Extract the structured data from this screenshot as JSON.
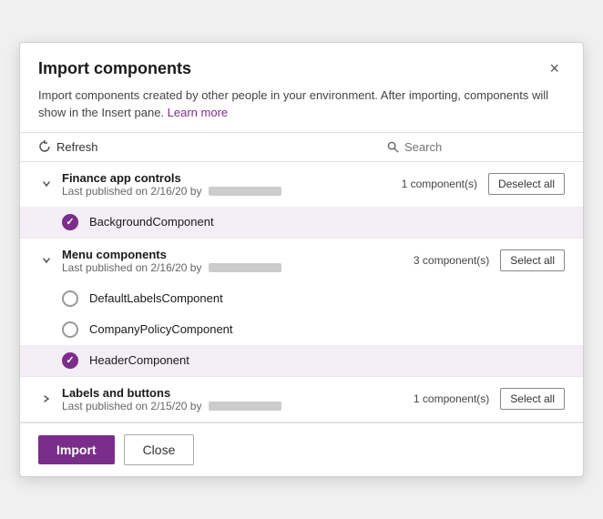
{
  "dialog": {
    "title": "Import components",
    "description": "Import components created by other people in your environment. After importing, components will show in the Insert pane.",
    "learn_more_label": "Learn more",
    "close_icon": "×"
  },
  "toolbar": {
    "refresh_label": "Refresh",
    "search_placeholder": "Search"
  },
  "sections": [
    {
      "id": "finance",
      "name": "Finance app controls",
      "meta": "Last published on 2/16/20 by",
      "component_count": "1 component(s)",
      "action_label": "Deselect all",
      "expanded": true,
      "components": [
        {
          "name": "BackgroundComponent",
          "selected": true
        }
      ]
    },
    {
      "id": "menu",
      "name": "Menu components",
      "meta": "Last published on 2/16/20 by",
      "component_count": "3 component(s)",
      "action_label": "Select all",
      "expanded": true,
      "components": [
        {
          "name": "DefaultLabelsComponent",
          "selected": false
        },
        {
          "name": "CompanyPolicyComponent",
          "selected": false
        },
        {
          "name": "HeaderComponent",
          "selected": true
        }
      ]
    },
    {
      "id": "labels",
      "name": "Labels and buttons",
      "meta": "Last published on 2/15/20 by",
      "component_count": "1 component(s)",
      "action_label": "Select all",
      "expanded": false,
      "components": []
    }
  ],
  "footer": {
    "import_label": "Import",
    "close_label": "Close"
  }
}
